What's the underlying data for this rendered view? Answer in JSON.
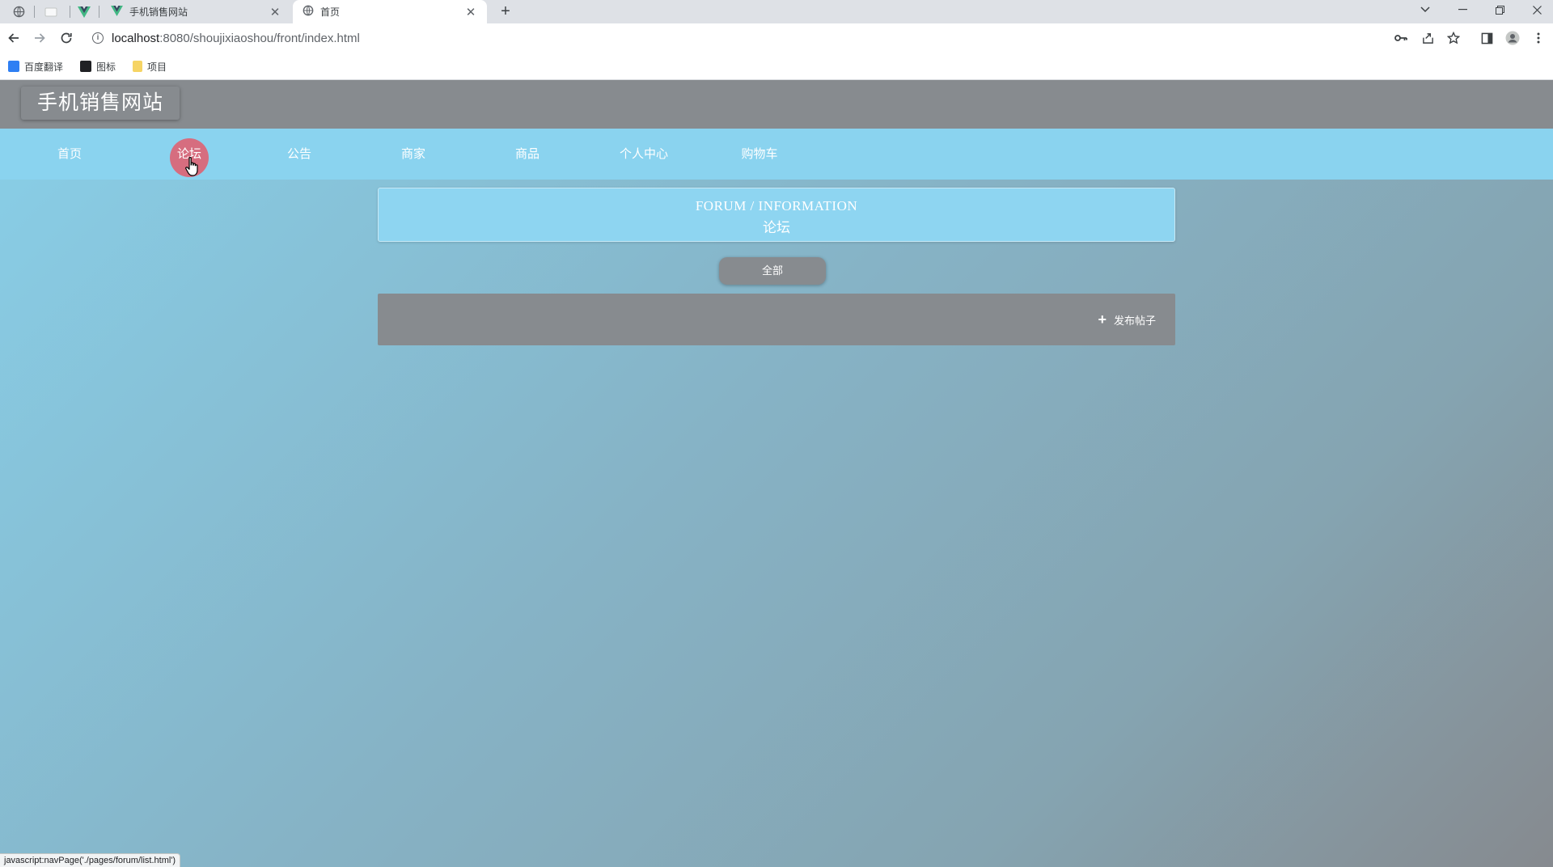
{
  "browser": {
    "tabs": [
      {
        "title": "手机销售网站",
        "active": false
      },
      {
        "title": "首页",
        "active": true
      }
    ],
    "new_tab": "+",
    "url_host": "localhost",
    "url_path": ":8080/shoujixiaoshou/front/index.html",
    "bookmarks": [
      {
        "label": "百度翻译",
        "icon": "baidu-translate-icon"
      },
      {
        "label": "图标",
        "icon": "image-icon"
      },
      {
        "label": "项目",
        "icon": "folder-icon"
      }
    ],
    "status_text": "javascript:navPage('./pages/forum/list.html')"
  },
  "site": {
    "title": "手机销售网站"
  },
  "nav": {
    "items": [
      {
        "label": "首页"
      },
      {
        "label": "论坛"
      },
      {
        "label": "公告"
      },
      {
        "label": "商家"
      },
      {
        "label": "商品"
      },
      {
        "label": "个人中心"
      },
      {
        "label": "购物车"
      }
    ],
    "active_index": 1,
    "active_color": "#d66d7f"
  },
  "banner": {
    "title_en": "FORUM / INFORMATION",
    "title_cn": "论坛"
  },
  "filter": {
    "label": "全部"
  },
  "actions": {
    "post_label": "发布帖子",
    "post_icon": "plus-icon"
  },
  "colors": {
    "nav_bg": "#8ad3ef",
    "header_bg": "#878b8f",
    "button_bg": "#878b8f"
  }
}
